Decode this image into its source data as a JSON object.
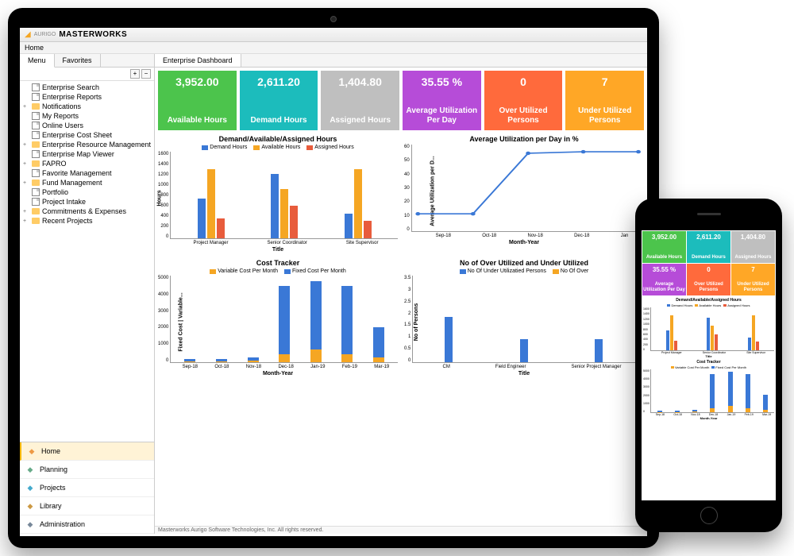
{
  "app": {
    "brand_prefix": "AURIGO",
    "brand_name": "MASTERWORKS"
  },
  "breadcrumb": "Home",
  "sidebar": {
    "tabs": [
      {
        "label": "Menu",
        "active": true
      },
      {
        "label": "Favorites",
        "active": false
      }
    ],
    "tree": [
      {
        "label": "Enterprise Search",
        "icon": "doc",
        "expand": null
      },
      {
        "label": "Enterprise Reports",
        "icon": "doc",
        "expand": null
      },
      {
        "label": "Notifications",
        "icon": "folder",
        "expand": "+"
      },
      {
        "label": "My Reports",
        "icon": "doc",
        "expand": null
      },
      {
        "label": "Online Users",
        "icon": "doc",
        "expand": null
      },
      {
        "label": "Enterprise Cost Sheet",
        "icon": "doc",
        "expand": null
      },
      {
        "label": "Enterprise Resource Management",
        "icon": "folder",
        "expand": "+"
      },
      {
        "label": "Enterprise Map Viewer",
        "icon": "doc",
        "expand": null
      },
      {
        "label": "FAPRO",
        "icon": "folder",
        "expand": "+"
      },
      {
        "label": "Favorite Management",
        "icon": "doc",
        "expand": null
      },
      {
        "label": "Fund Management",
        "icon": "folder",
        "expand": "+"
      },
      {
        "label": "Portfolio",
        "icon": "doc",
        "expand": null
      },
      {
        "label": "Project Intake",
        "icon": "doc",
        "expand": null
      },
      {
        "label": "Commitments & Expenses",
        "icon": "folder",
        "expand": "+"
      },
      {
        "label": "Recent Projects",
        "icon": "folder",
        "expand": "+"
      }
    ],
    "nav": [
      {
        "label": "Home",
        "icon": "home-icon",
        "color": "#e94",
        "active": true
      },
      {
        "label": "Planning",
        "icon": "planning-icon",
        "color": "#6a8",
        "active": false
      },
      {
        "label": "Projects",
        "icon": "projects-icon",
        "color": "#4ac",
        "active": false
      },
      {
        "label": "Library",
        "icon": "library-icon",
        "color": "#c94",
        "active": false
      },
      {
        "label": "Administration",
        "icon": "admin-icon",
        "color": "#789",
        "active": false
      }
    ]
  },
  "main_tab": "Enterprise Dashboard",
  "kpis": [
    {
      "value": "3,952.00",
      "label": "Available Hours",
      "bg": "#4cc44c"
    },
    {
      "value": "2,611.20",
      "label": "Demand Hours",
      "bg": "#1cbcbc"
    },
    {
      "value": "1,404.80",
      "label": "Assigned Hours",
      "bg": "#bfbfbf"
    },
    {
      "value": "35.55 %",
      "label": "Average Utilization Per Day",
      "bg": "#b64cd8"
    },
    {
      "value": "0",
      "label": "Over Utilized Persons",
      "bg": "#ff6a3c"
    },
    {
      "value": "7",
      "label": "Under Utilized Persons",
      "bg": "#ffa726"
    }
  ],
  "footer": "Masterworks Aurigo Software Technologies, Inc. All rights reserved.",
  "colors": {
    "blue": "#3a78d6",
    "orange": "#f5a623",
    "red": "#e85c3c"
  },
  "chart_data": [
    {
      "type": "bar",
      "title": "Demand/Available/Assigned Hours",
      "xlabel": "Title",
      "ylabel": "Hours",
      "ylim": [
        0,
        1600
      ],
      "yticks": [
        0,
        200,
        400,
        600,
        800,
        1000,
        1200,
        1400,
        1600
      ],
      "categories": [
        "Project Manager",
        "Senior Coordinator",
        "Site Supervisor"
      ],
      "series": [
        {
          "name": "Demand Hours",
          "color": "#3a78d6",
          "values": [
            800,
            1300,
            500
          ]
        },
        {
          "name": "Available Hours",
          "color": "#f5a623",
          "values": [
            1400,
            1000,
            1400
          ]
        },
        {
          "name": "Assigned Hours",
          "color": "#e85c3c",
          "values": [
            400,
            650,
            350
          ]
        }
      ]
    },
    {
      "type": "line",
      "title": "Average Utilization per Day in %",
      "xlabel": "Month-Year",
      "ylabel": "Average Utilization per D...",
      "ylim": [
        0,
        60
      ],
      "yticks": [
        0,
        10,
        20,
        30,
        40,
        50,
        60
      ],
      "categories": [
        "Sep-18",
        "Oct-18",
        "Nov-18",
        "Dec-18",
        "Jan"
      ],
      "series": [
        {
          "name": "Utilization",
          "color": "#3a78d6",
          "values": [
            12,
            12,
            54,
            55,
            55
          ]
        }
      ]
    },
    {
      "type": "bar",
      "stacked": true,
      "title": "Cost Tracker",
      "xlabel": "Month-Year",
      "ylabel": "Fixed Cost | Variable...",
      "ylim": [
        0,
        5000
      ],
      "yticks": [
        0,
        1000,
        2000,
        3000,
        4000,
        5000
      ],
      "categories": [
        "Sep-18",
        "Oct-18",
        "Nov-18",
        "Dec-18",
        "Jan-19",
        "Feb-19",
        "Mar-19"
      ],
      "series": [
        {
          "name": "Variable Cost Per Month",
          "color": "#f5a623",
          "values": [
            50,
            50,
            100,
            500,
            800,
            500,
            300
          ]
        },
        {
          "name": "Fixed Cost Per Month",
          "color": "#3a78d6",
          "values": [
            150,
            150,
            200,
            4300,
            4300,
            4300,
            1900
          ]
        }
      ]
    },
    {
      "type": "bar",
      "title": "No of Over Utilized and Under Utilized",
      "xlabel": "Title",
      "ylabel": "No of Persons",
      "ylim": [
        0,
        3.5
      ],
      "yticks": [
        0,
        0.5,
        1,
        1.5,
        2,
        2.5,
        3,
        3.5
      ],
      "categories": [
        "CM",
        "Field Engineer",
        "Senior Project Manager"
      ],
      "series": [
        {
          "name": "No Of Under Utilizatied Persons",
          "color": "#3a78d6",
          "values": [
            2,
            1,
            1
          ]
        },
        {
          "name": "No Of Over",
          "color": "#f5a623",
          "values": [
            0,
            0,
            0
          ]
        }
      ]
    }
  ]
}
